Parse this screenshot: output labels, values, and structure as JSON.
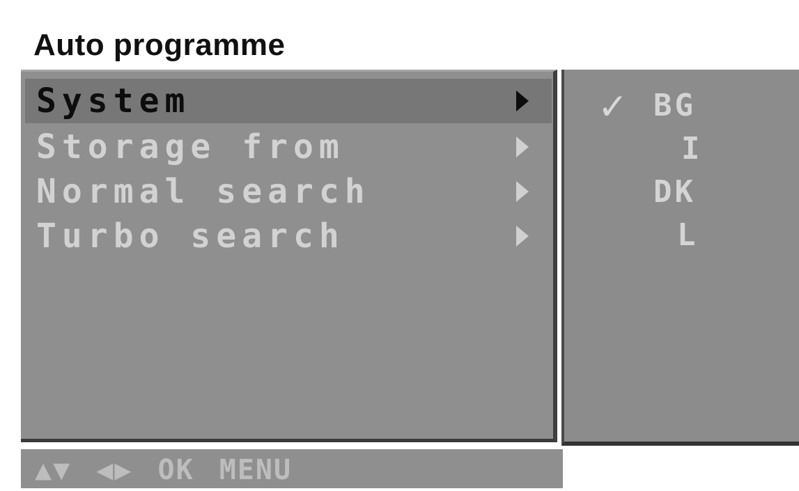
{
  "screen_title": "Auto programme",
  "menu": {
    "items": [
      {
        "label": "System",
        "selected": true
      },
      {
        "label": "Storage from",
        "selected": false
      },
      {
        "label": "Normal search",
        "selected": false
      },
      {
        "label": "Turbo search",
        "selected": false
      }
    ]
  },
  "submenu": {
    "checkmark": "✓",
    "options": [
      "BG",
      "I",
      "DK",
      "L"
    ],
    "checked_option": "BG"
  },
  "hint_bar": {
    "text": "▲▼ ◀▶ OK MENU"
  },
  "colors": {
    "panel_bg": "#8f8f8f",
    "selected_row_bg": "#777777",
    "selected_text": "#0d0d0d",
    "inactive_text": "#d2d2d2"
  }
}
